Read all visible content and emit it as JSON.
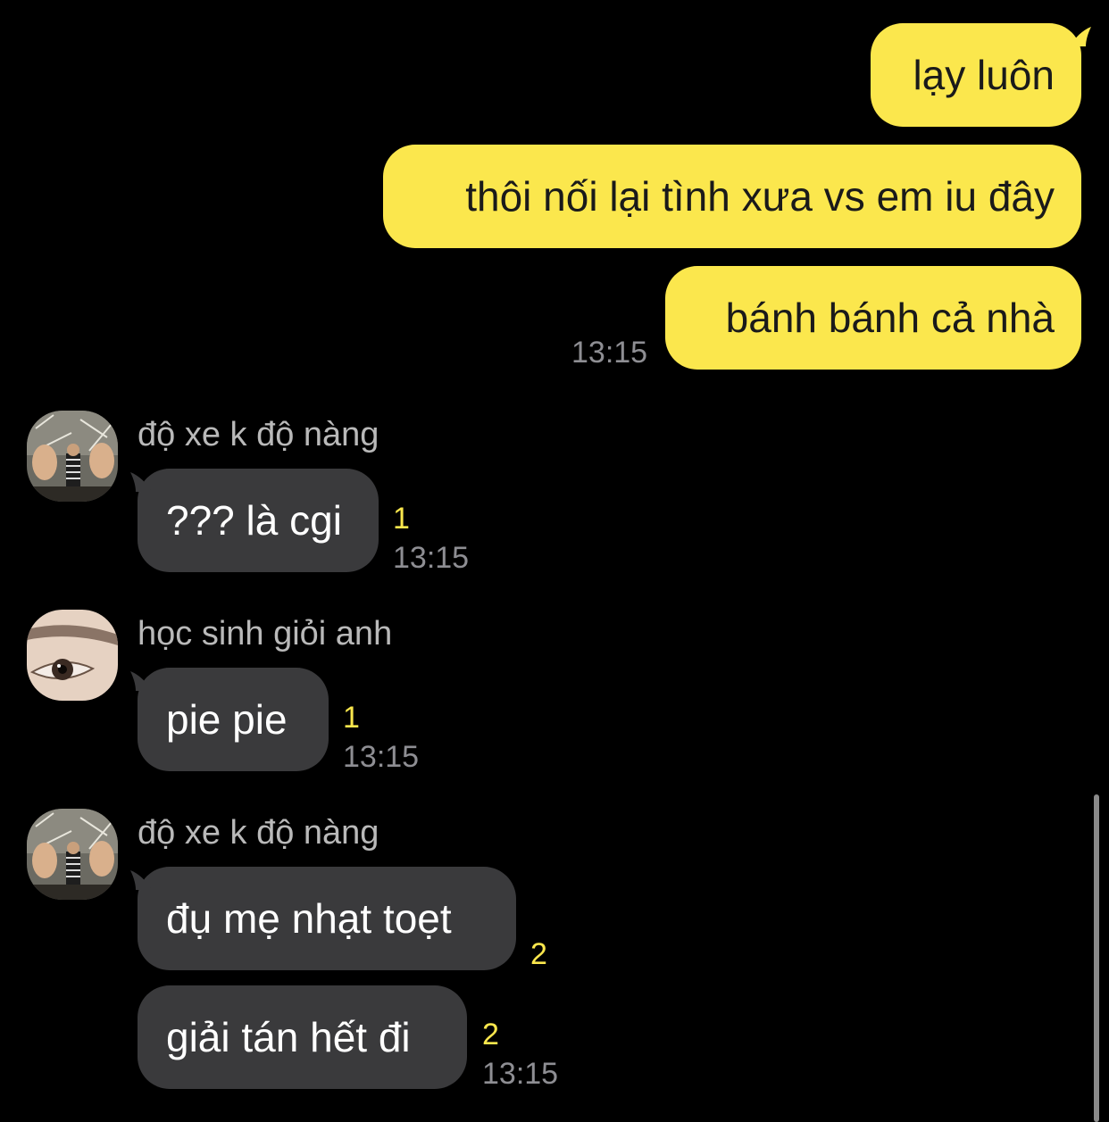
{
  "outgoing": {
    "messages": [
      {
        "text": "lạy luôn"
      },
      {
        "text": "thôi nối lại tình xưa vs em iu đây"
      },
      {
        "text": "bánh bánh cả nhà"
      }
    ],
    "time": "13:15"
  },
  "incoming": [
    {
      "sender": "độ xe k độ nàng",
      "avatar": "thumbs-up-person-avatar",
      "messages": [
        {
          "text": "??? là cgi",
          "unread": "1"
        }
      ],
      "time": "13:15"
    },
    {
      "sender": "học sinh giỏi anh",
      "avatar": "eye-closeup-avatar",
      "messages": [
        {
          "text": "pie pie",
          "unread": "1"
        }
      ],
      "time": "13:15"
    },
    {
      "sender": "độ xe k độ nàng",
      "avatar": "thumbs-up-person-avatar",
      "messages": [
        {
          "text": "đụ mẹ nhạt toẹt",
          "unread": "2"
        },
        {
          "text": "giải tán hết đi",
          "unread": "2"
        }
      ],
      "time": "13:15"
    }
  ],
  "colors": {
    "background": "#000000",
    "outgoing_bubble": "#fbe74d",
    "incoming_bubble": "#3a3a3c",
    "unread_count": "#fbe74d",
    "timestamp": "#8e8e93"
  }
}
